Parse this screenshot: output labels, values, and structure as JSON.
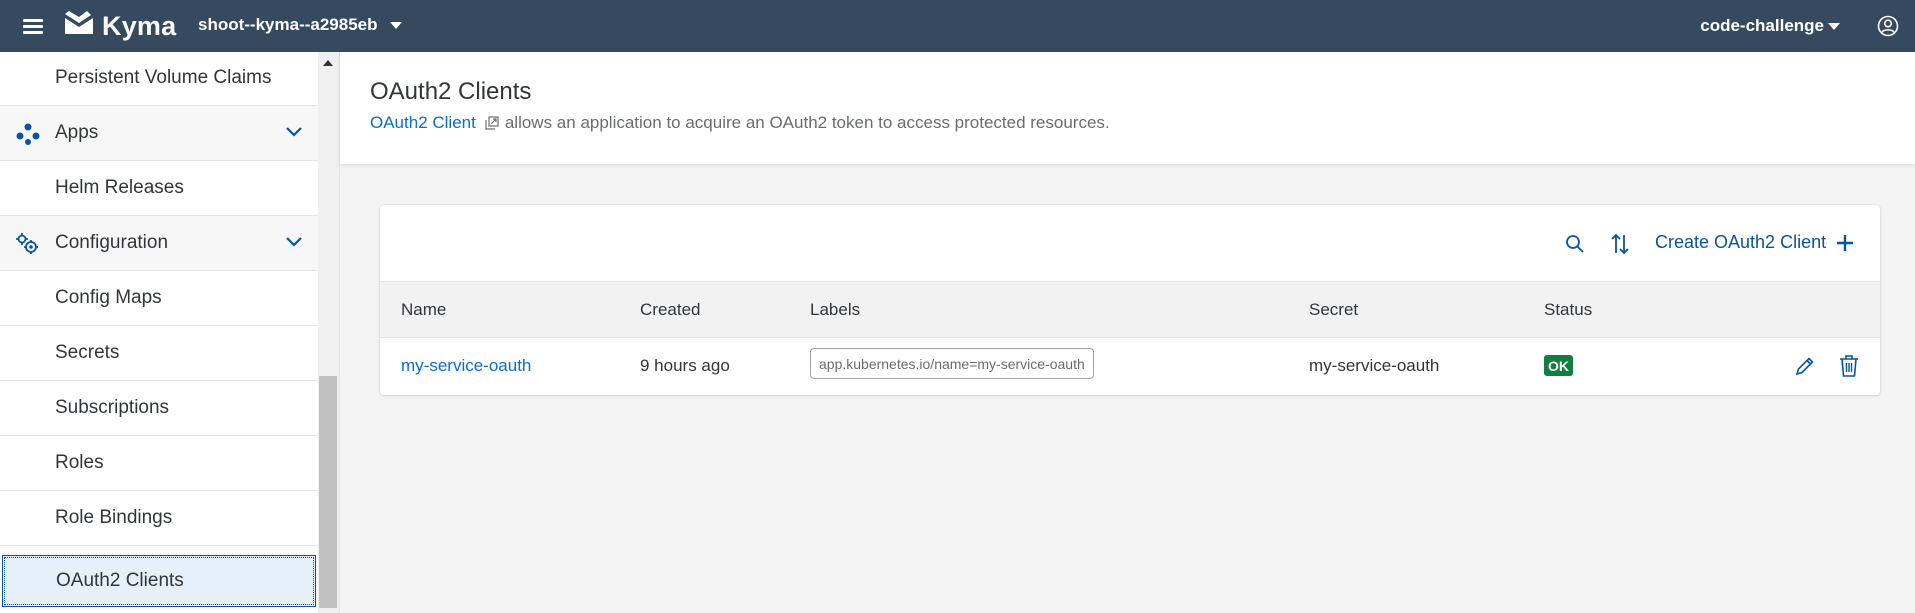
{
  "shellbar": {
    "product_name": "Kyma",
    "cluster_name": "shoot--kyma--a2985eb",
    "namespace": "code-challenge",
    "icons": {
      "menu": "hamburger-menu-icon",
      "logo": "kyma-logo",
      "user": "user-account-icon"
    }
  },
  "sidebar": {
    "items": [
      {
        "label": "Persistent Volume Claims",
        "type": "item"
      },
      {
        "label": "Apps",
        "type": "group",
        "icon": "apps-icon"
      },
      {
        "label": "Helm Releases",
        "type": "item"
      },
      {
        "label": "Configuration",
        "type": "group",
        "icon": "configuration-icon"
      },
      {
        "label": "Config Maps",
        "type": "item"
      },
      {
        "label": "Secrets",
        "type": "item"
      },
      {
        "label": "Subscriptions",
        "type": "item"
      },
      {
        "label": "Roles",
        "type": "item"
      },
      {
        "label": "Role Bindings",
        "type": "item"
      },
      {
        "label": "OAuth2 Clients",
        "type": "item",
        "selected": true
      }
    ]
  },
  "page": {
    "title": "OAuth2 Clients",
    "description_link": "OAuth2 Client",
    "description_text": "allows an application to acquire an OAuth2 token to access protected resources."
  },
  "toolbar": {
    "create_label": "Create OAuth2 Client",
    "icons": {
      "search": "search-icon",
      "sort": "sort-icon",
      "create": "plus-icon"
    }
  },
  "table": {
    "headers": [
      "Name",
      "Created",
      "Labels",
      "Secret",
      "Status"
    ],
    "rows": [
      {
        "name": "my-service-oauth",
        "created": "9 hours ago",
        "labels": "app.kubernetes.io/name=my-service-oauth",
        "secret": "my-service-oauth",
        "status": "OK"
      }
    ]
  },
  "colors": {
    "shellbar": "#354a5f",
    "link": "#0a6ed1",
    "accent": "#0854a0",
    "status_ok": "#107e3e",
    "selected_bg": "#e5f0fa"
  }
}
